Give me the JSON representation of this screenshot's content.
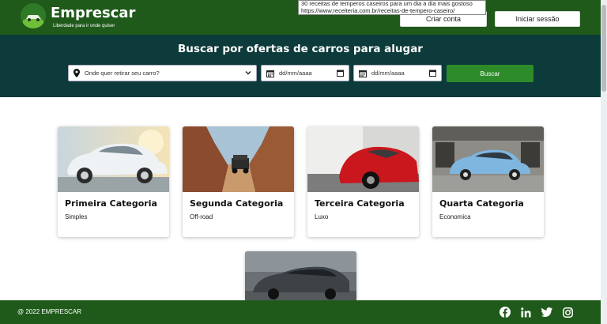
{
  "header": {
    "brand": "Emprescar",
    "tagline": "Liberdade para ir onde quiser",
    "create_label": "Criar conta",
    "login_label": "Iniciar sessão"
  },
  "tooltip": {
    "line1": "30 receitas de temperos caseiros para um dia a dia mais gostoso",
    "line2": "https://www.receiteria.com.br/receitas-de-tempero-caseiro/"
  },
  "search": {
    "title": "Buscar por ofertas de carros para alugar",
    "location_placeholder": "Onde quer retirar seu carro?",
    "date_placeholder": "dd/mm/aaaa",
    "date2_placeholder": "dd/mm/aaaa",
    "button_label": "Buscar"
  },
  "categories": [
    {
      "title": "Primeira Categoria",
      "subtitle": "Simples"
    },
    {
      "title": "Segunda Categoria",
      "subtitle": "Off-road"
    },
    {
      "title": "Terceira Categoria",
      "subtitle": "Luxo"
    },
    {
      "title": "Quarta Categoria",
      "subtitle": "Economica"
    }
  ],
  "footer": {
    "copyright": "@ 2022 EMPRESCAR"
  },
  "colors": {
    "header_green": "#1f5a1a",
    "band_teal": "#0d3a3a",
    "button_green": "#2e8b2a"
  },
  "icons": [
    "location-pin-icon",
    "calendar-icon",
    "dropdown-chevron-icon",
    "facebook-icon",
    "linkedin-icon",
    "twitter-icon",
    "instagram-icon"
  ]
}
